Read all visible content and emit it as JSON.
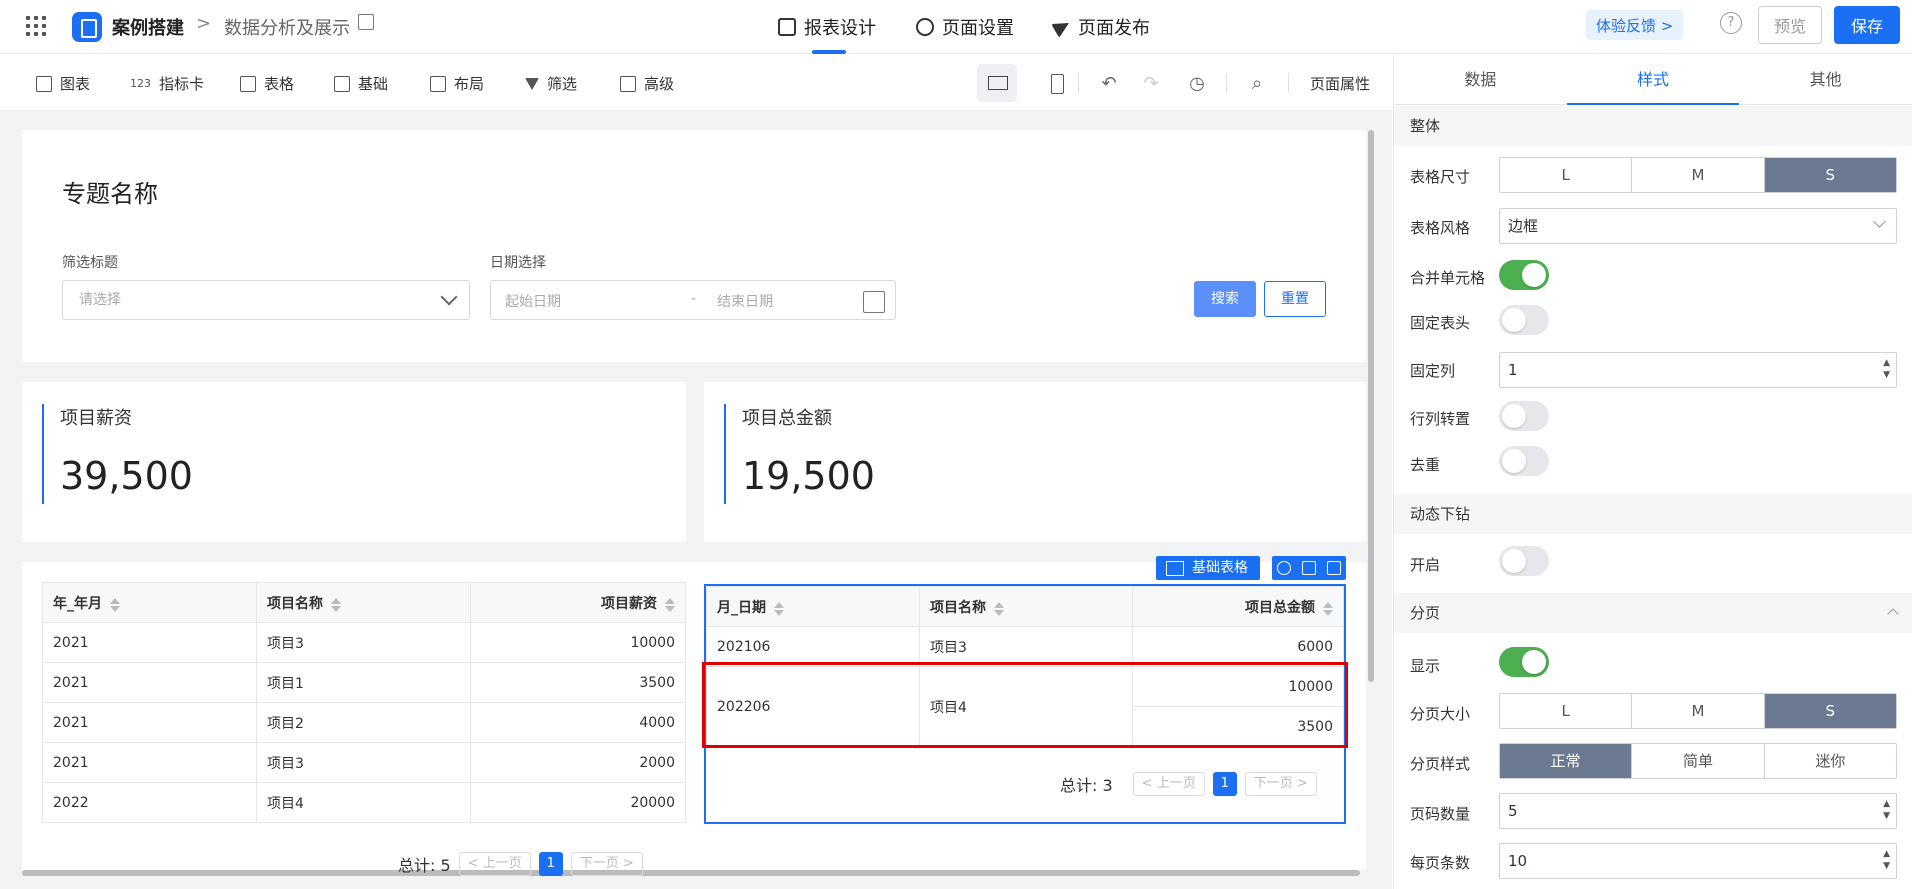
{
  "header": {
    "crumb_root": "案例搭建",
    "crumb_sep": ">",
    "crumb_page": "数据分析及展示",
    "tabs": [
      {
        "label": "报表设计",
        "icon": "report-icon",
        "active": true
      },
      {
        "label": "页面设置",
        "icon": "gear-icon",
        "active": false
      },
      {
        "label": "页面发布",
        "icon": "send-icon",
        "active": false
      }
    ],
    "feedback": "体验反馈 >",
    "help": "?",
    "preview": "预览",
    "save": "保存",
    "accent_color": "#1a6ff2"
  },
  "toolbar": {
    "items": [
      {
        "label": "图表",
        "icon": "bar-chart-icon"
      },
      {
        "label": "指标卡",
        "icon": "number-icon",
        "icon_text": "123"
      },
      {
        "label": "表格",
        "icon": "table-icon"
      },
      {
        "label": "基础",
        "icon": "grid-icon"
      },
      {
        "label": "布局",
        "icon": "layout-icon"
      },
      {
        "label": "筛选",
        "icon": "filter-icon"
      },
      {
        "label": "高级",
        "icon": "layers-icon"
      }
    ],
    "page_props": "页面属性",
    "undo": "↶",
    "redo": "↷",
    "history": "◷",
    "search": "⌕"
  },
  "filter": {
    "title": "专题名称",
    "label1": "筛选标题",
    "select_placeholder": "请选择",
    "label2": "日期选择",
    "start_placeholder": "起始日期",
    "date_sep": "-",
    "end_placeholder": "结束日期",
    "search_btn": "搜索",
    "reset_btn": "重置"
  },
  "kpis": [
    {
      "title": "项目薪资",
      "value": "39,500"
    },
    {
      "title": "项目总金额",
      "value": "19,500"
    }
  ],
  "table1": {
    "headers": [
      "年_年月",
      "项目名称",
      "项目薪资"
    ],
    "rows": [
      [
        "2021",
        "项目3",
        "10000"
      ],
      [
        "2021",
        "项目1",
        "3500"
      ],
      [
        "2021",
        "项目2",
        "4000"
      ],
      [
        "2021",
        "项目3",
        "2000"
      ],
      [
        "2022",
        "项目4",
        "20000"
      ]
    ],
    "total": "总计: 5",
    "prev": "< 上一页",
    "page": "1",
    "next": "下一页 >"
  },
  "table2": {
    "tag": "基础表格",
    "headers": [
      "月_日期",
      "项目名称",
      "项目总金额"
    ],
    "row1": [
      "202106",
      "项目3",
      "6000"
    ],
    "row2": {
      "date": "202206",
      "name": "项目4",
      "v1": "10000",
      "v2": "3500"
    },
    "total": "总计: 3",
    "prev": "< 上一页",
    "page": "1",
    "next": "下一页 >"
  },
  "sidebar": {
    "tabs": [
      {
        "label": "数据",
        "active": false
      },
      {
        "label": "样式",
        "active": true
      },
      {
        "label": "其他",
        "active": false
      }
    ],
    "sec_overall": "整体",
    "table_size_label": "表格尺寸",
    "sizes": [
      "L",
      "M",
      "S"
    ],
    "table_size_selected": "S",
    "table_style_label": "表格风格",
    "table_style_value": "边框",
    "merge_label": "合并单元格",
    "merge_on": true,
    "fixed_header_label": "固定表头",
    "fixed_header_on": false,
    "fixed_col_label": "固定列",
    "fixed_col_value": "1",
    "transpose_label": "行列转置",
    "transpose_on": false,
    "dedupe_label": "去重",
    "dedupe_on": false,
    "sec_drill": "动态下钻",
    "drill_label": "开启",
    "drill_on": false,
    "sec_paging": "分页",
    "show_label": "显示",
    "show_on": true,
    "page_size_label": "分页大小",
    "page_size_selected": "S",
    "page_style_label": "分页样式",
    "page_styles": [
      "正常",
      "简单",
      "迷你"
    ],
    "page_style_selected": "正常",
    "page_count_label": "页码数量",
    "page_count_value": "5",
    "per_page_label": "每页条数",
    "per_page_value": "10"
  }
}
